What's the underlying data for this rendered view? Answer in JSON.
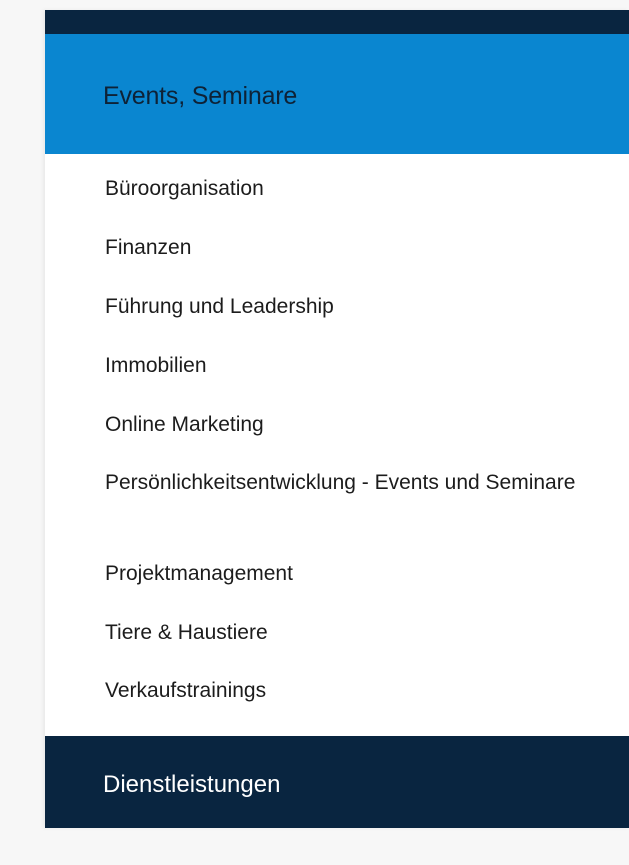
{
  "colors": {
    "top_bar": "#092540",
    "section_header": "#0a86d0",
    "section_header_text": "#0e2236",
    "footer_bar": "#092540",
    "footer_text": "#ffffff",
    "item_text": "#1c1c1c"
  },
  "section": {
    "title": "Events, Seminare"
  },
  "menu": {
    "items": [
      {
        "label": "Büroorganisation"
      },
      {
        "label": "Finanzen"
      },
      {
        "label": "Führung und Leadership"
      },
      {
        "label": "Immobilien"
      },
      {
        "label": "Online Marketing"
      },
      {
        "label": "Persönlichkeitsentwicklung - Events und Seminare"
      },
      {
        "label": "Projektmanagement"
      },
      {
        "label": "Tiere & Haustiere"
      },
      {
        "label": "Verkaufstrainings"
      }
    ]
  },
  "footer": {
    "title": "Dienstleistungen"
  }
}
